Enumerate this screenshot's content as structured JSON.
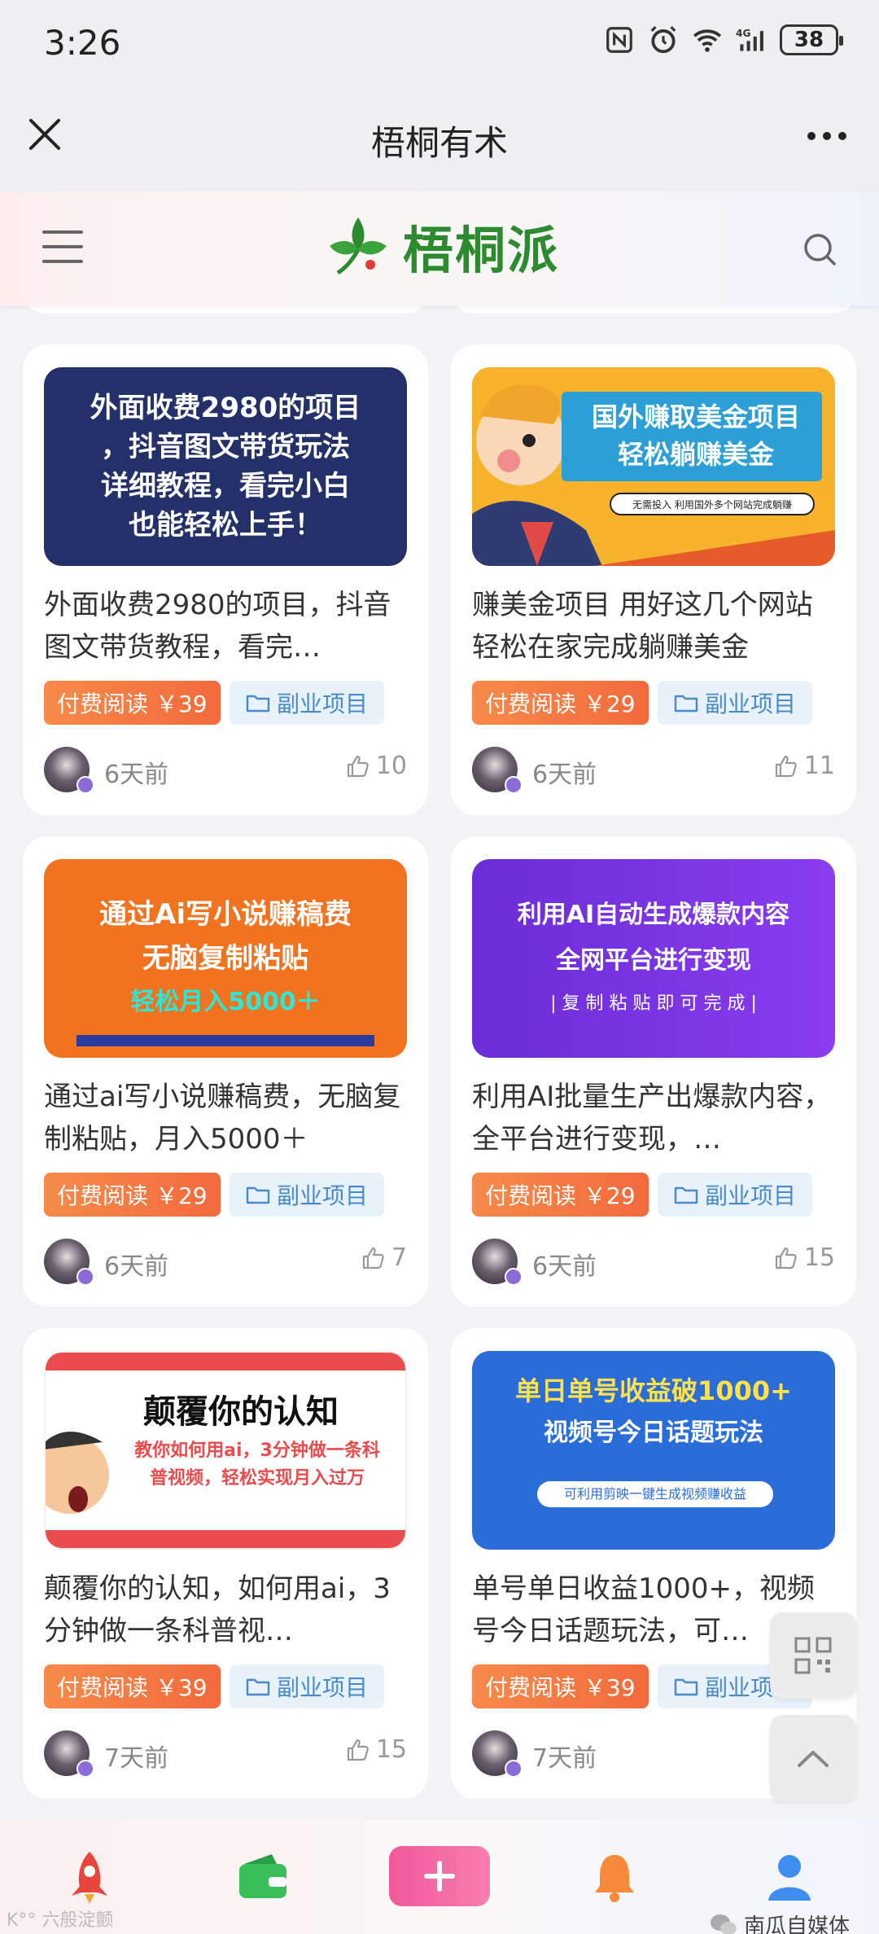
{
  "status_bar": {
    "time": "3:26",
    "battery": "38"
  },
  "title_bar": {
    "title": "梧桐有术"
  },
  "site_header": {
    "logo_text": "梧桐派"
  },
  "cards": [
    {
      "thumb_lines": [
        "外面收费2980的项目",
        "，抖音图文带货玩法",
        "详细教程，看完小白",
        "也能轻松上手！"
      ],
      "title": "外面收费2980的项目，抖音图文带货教程，看完…",
      "price": "付费阅读 ￥39",
      "category": "副业项目",
      "time": "6天前",
      "likes": "10"
    },
    {
      "thumb_lines": [
        "国外赚取美金项目",
        "轻松躺赚美金",
        "无需投入 利用国外多个网站完成躺赚"
      ],
      "title": "赚美金项目 用好这几个网站 轻松在家完成躺赚美金",
      "price": "付费阅读 ￥29",
      "category": "副业项目",
      "time": "6天前",
      "likes": "11"
    },
    {
      "thumb_lines": [
        "通过Ai写小说赚稿费",
        "无脑复制粘贴",
        "轻松月入5000＋"
      ],
      "title": "通过ai写小说赚稿费，无脑复制粘贴，月入5000＋",
      "price": "付费阅读 ￥29",
      "category": "副业项目",
      "time": "6天前",
      "likes": "7"
    },
    {
      "thumb_lines": [
        "利用AI自动生成爆款内容",
        "全网平台进行变现",
        "| 复 制 粘 贴 即 可 完 成 |"
      ],
      "title": "利用AI批量生产出爆款内容，全平台进行变现，…",
      "price": "付费阅读 ￥29",
      "category": "副业项目",
      "time": "6天前",
      "likes": "15"
    },
    {
      "thumb_lines": [
        "颠覆你的认知",
        "教你如何用ai，3分钟做一条科",
        "普视频，轻松实现月入过万"
      ],
      "title": "颠覆你的认知，如何用ai，3分钟做一条科普视…",
      "price": "付费阅读 ￥39",
      "category": "副业项目",
      "time": "7天前",
      "likes": "15"
    },
    {
      "thumb_lines": [
        "单日单号收益破1000+",
        "视频号今日话题玩法",
        "可利用剪映一键生成视频赚收益"
      ],
      "title": "单号单日收益1000+，视频号今日话题玩法，可…",
      "price": "付费阅读 ￥39",
      "category": "副业项目",
      "time": "7天前",
      "likes": ""
    }
  ],
  "watermarks": {
    "left": "K°° 六般淀颤",
    "right": "南瓜自媒体"
  },
  "colors": {
    "price_tag": "#f26a3c",
    "category_tag": "#4a8ac9",
    "brand_green": "#2c8a2f",
    "plus_button": "#f0599a"
  }
}
